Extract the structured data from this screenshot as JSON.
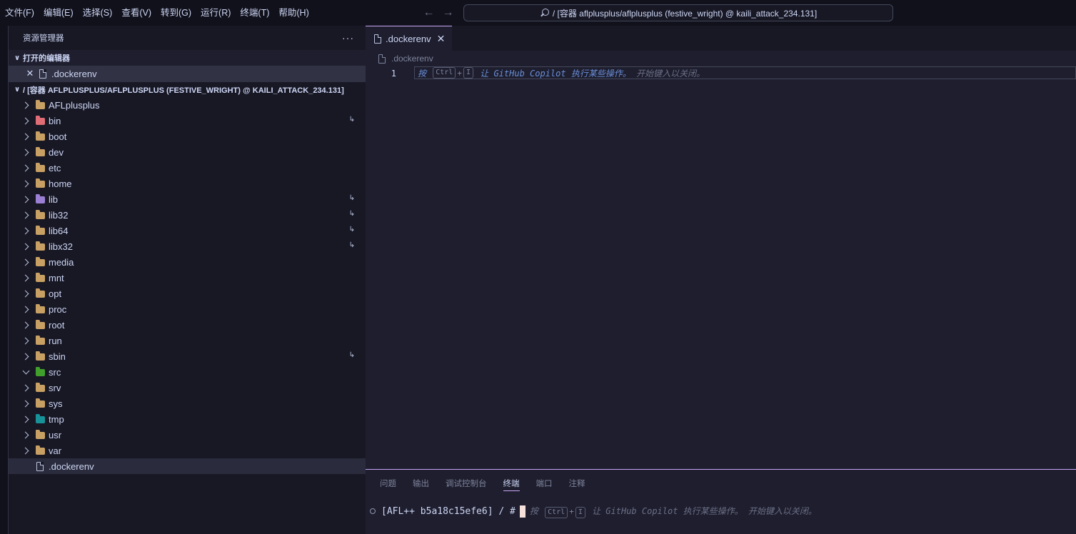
{
  "menubar": {
    "items": [
      "文件(F)",
      "编辑(E)",
      "选择(S)",
      "查看(V)",
      "转到(G)",
      "运行(R)",
      "终端(T)",
      "帮助(H)"
    ]
  },
  "command_center": {
    "text": "/ [容器 aflplusplus/aflplusplus (festive_wright) @ kaili_attack_234.131]"
  },
  "sidebar": {
    "title": "资源管理器",
    "more": "···",
    "open_editors": {
      "title": "打开的编辑器",
      "items": [
        {
          "label": ".dockerenv"
        }
      ]
    },
    "workspace": {
      "title": "/ [容器 AFLPLUSPLUS/AFLPLUSPLUS (FESTIVE_WRIGHT) @ KAILI_ATTACK_234.131]",
      "items": [
        {
          "label": "AFLplusplus",
          "kind": "folder",
          "symlink": false,
          "expanded": false
        },
        {
          "label": "bin",
          "kind": "folder-bin",
          "symlink": true,
          "expanded": false
        },
        {
          "label": "boot",
          "kind": "folder",
          "symlink": false,
          "expanded": false
        },
        {
          "label": "dev",
          "kind": "folder",
          "symlink": false,
          "expanded": false
        },
        {
          "label": "etc",
          "kind": "folder",
          "symlink": false,
          "expanded": false
        },
        {
          "label": "home",
          "kind": "folder",
          "symlink": false,
          "expanded": false
        },
        {
          "label": "lib",
          "kind": "folder-lib",
          "symlink": true,
          "expanded": false
        },
        {
          "label": "lib32",
          "kind": "folder",
          "symlink": true,
          "expanded": false
        },
        {
          "label": "lib64",
          "kind": "folder",
          "symlink": true,
          "expanded": false
        },
        {
          "label": "libx32",
          "kind": "folder",
          "symlink": true,
          "expanded": false
        },
        {
          "label": "media",
          "kind": "folder",
          "symlink": false,
          "expanded": false
        },
        {
          "label": "mnt",
          "kind": "folder",
          "symlink": false,
          "expanded": false
        },
        {
          "label": "opt",
          "kind": "folder",
          "symlink": false,
          "expanded": false
        },
        {
          "label": "proc",
          "kind": "folder",
          "symlink": false,
          "expanded": false
        },
        {
          "label": "root",
          "kind": "folder",
          "symlink": false,
          "expanded": false
        },
        {
          "label": "run",
          "kind": "folder",
          "symlink": false,
          "expanded": false
        },
        {
          "label": "sbin",
          "kind": "folder",
          "symlink": true,
          "expanded": false
        },
        {
          "label": "src",
          "kind": "folder-src",
          "symlink": false,
          "expanded": true
        },
        {
          "label": "srv",
          "kind": "folder",
          "symlink": false,
          "expanded": false
        },
        {
          "label": "sys",
          "kind": "folder",
          "symlink": false,
          "expanded": false
        },
        {
          "label": "tmp",
          "kind": "folder-tmp",
          "symlink": false,
          "expanded": false
        },
        {
          "label": "usr",
          "kind": "folder",
          "symlink": false,
          "expanded": false
        },
        {
          "label": "var",
          "kind": "folder",
          "symlink": false,
          "expanded": false
        },
        {
          "label": ".dockerenv",
          "kind": "file",
          "symlink": false,
          "selected": true
        }
      ]
    }
  },
  "editor": {
    "tab": {
      "label": ".dockerenv"
    },
    "breadcrumb": ".dockerenv",
    "line_number": "1",
    "hint": {
      "press": "按",
      "key1": "Ctrl",
      "plus": "+",
      "key2": "I",
      "accent": "让 GitHub Copilot",
      "action": "执行某些操作。",
      "dismiss": "开始键入以关闭。"
    }
  },
  "panel": {
    "tabs": [
      "问题",
      "输出",
      "调试控制台",
      "终端",
      "端口",
      "注释"
    ],
    "active_tab": "终端",
    "terminal": {
      "prompt": "[AFL++ b5a18c15efe6] / #",
      "hint": {
        "press": "按",
        "key1": "Ctrl",
        "plus": "+",
        "key2": "I",
        "text": "让 GitHub Copilot 执行某些操作。 开始键入以关闭。"
      }
    }
  },
  "colors": {
    "accent": "#cba6f7",
    "background": "#1e1e2e",
    "sidebar": "#181825",
    "hint_accent": "#6a8fd8"
  }
}
